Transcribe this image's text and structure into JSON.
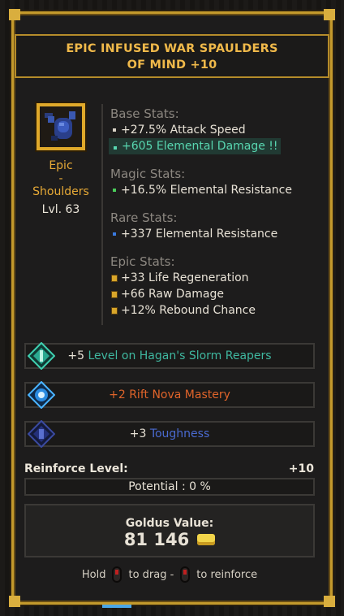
{
  "item": {
    "title_line1": "EPIC INFUSED WAR SPAULDERS",
    "title_line2": "OF MIND",
    "upgrade": "+10",
    "rarity": "Epic",
    "rarity_sep": "-",
    "slot": "Shoulders",
    "level": "Lvl. 63",
    "icon": "shoulders-armor-icon"
  },
  "stats": {
    "base_header": "Base Stats:",
    "base": [
      "+27.5% Attack Speed",
      "+605 Elemental Damage !!"
    ],
    "magic_header": "Magic Stats:",
    "magic": [
      "+16.5% Elemental Resistance"
    ],
    "rare_header": "Rare Stats:",
    "rare": [
      "+337 Elemental Resistance"
    ],
    "epic_header": "Epic Stats:",
    "epic": [
      "+33 Life Regeneration",
      "+66 Raw Damage",
      "+12% Rebound Chance"
    ]
  },
  "abilities": [
    {
      "bonus": "+5",
      "name": "Level on Hagan's Slorm Reapers",
      "color": "#3fb8a0",
      "icon": "slorm-reapers-icon"
    },
    {
      "bonus": "+2",
      "name": "Rift Nova Mastery",
      "color": "#e0642a",
      "icon": "rift-nova-icon"
    },
    {
      "bonus": "+3",
      "name": "Toughness",
      "color": "#4a6ad0",
      "icon": "toughness-icon"
    }
  ],
  "reinforce": {
    "label": "Reinforce Level:",
    "value": "+10"
  },
  "potential": "Potential : 0 %",
  "goldus": {
    "label": "Goldus Value:",
    "value": "81 146"
  },
  "hint": {
    "hold": "Hold",
    "drag": "to drag -",
    "reinforce": "to reinforce"
  },
  "colors": {
    "gold_border": "#c49a2c",
    "title": "#f0b94a",
    "rarity": "#e6a936",
    "highlight": "#58d6b0"
  }
}
